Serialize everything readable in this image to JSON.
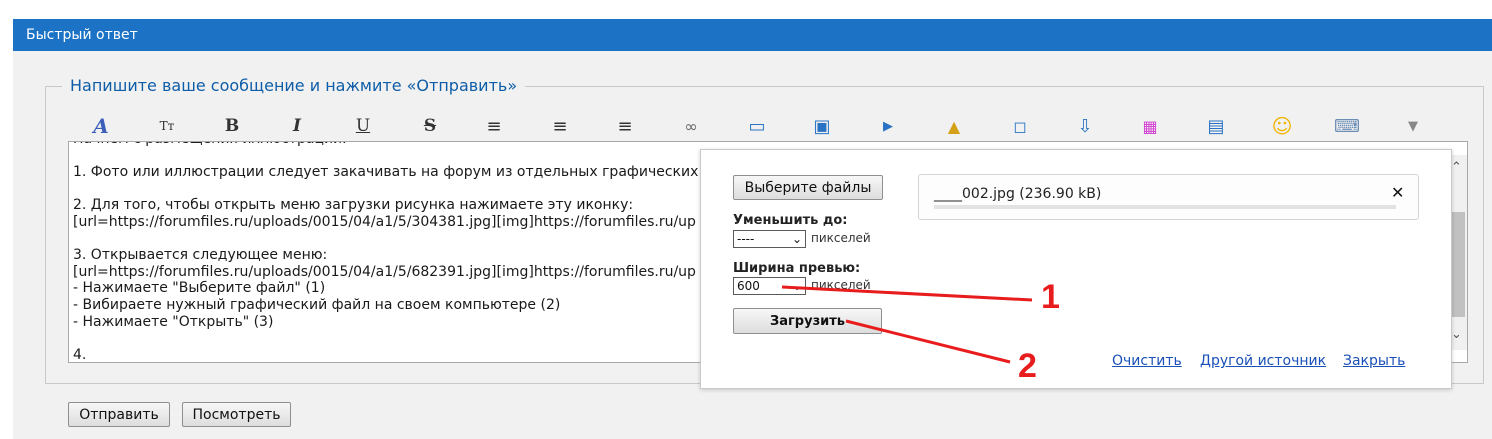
{
  "header": {
    "title": "Быстрый ответ"
  },
  "form": {
    "legend": "Напишите ваше сообщение и нажмите «Отправить»",
    "toolbar": [
      {
        "name": "font-color-icon",
        "glyph": "A"
      },
      {
        "name": "font-size-icon",
        "glyph": "Tт"
      },
      {
        "name": "bold-icon",
        "glyph": "B"
      },
      {
        "name": "italic-icon",
        "glyph": "I"
      },
      {
        "name": "underline-icon",
        "glyph": "U"
      },
      {
        "name": "strikethrough-icon",
        "glyph": "S"
      },
      {
        "name": "align-left-icon",
        "glyph": "≡"
      },
      {
        "name": "align-center-icon",
        "glyph": "≡"
      },
      {
        "name": "align-right-icon",
        "glyph": "≡"
      },
      {
        "name": "link-icon",
        "glyph": "∞"
      },
      {
        "name": "book-icon",
        "glyph": "▭"
      },
      {
        "name": "image-gallery-icon",
        "glyph": "▣"
      },
      {
        "name": "video-play-icon",
        "glyph": "▶"
      },
      {
        "name": "lock-icon",
        "glyph": "▲"
      },
      {
        "name": "quote-bubble-icon",
        "glyph": "◻"
      },
      {
        "name": "image-upload-icon",
        "glyph": "⇩"
      },
      {
        "name": "color-grid-icon",
        "glyph": "▦"
      },
      {
        "name": "table-icon",
        "glyph": "▤"
      },
      {
        "name": "smiley-icon",
        "glyph": "☺"
      },
      {
        "name": "keyboard-icon",
        "glyph": "⌨"
      },
      {
        "name": "more-dropdown-icon",
        "glyph": "▼"
      }
    ],
    "editor_text": "Начнем с размещения иллюстраций.\n\n1. Фото или иллюстрации следует закачивать на форум из отдельных графических фай\n\n2. Для того, чтобы открыть меню загрузки рисунка нажимаете эту иконку:\n[url=https://forumfiles.ru/uploads/0015/04/a1/5/304381.jpg][img]https://forumfiles.ru/up\n\n3. Открывается следующее меню:\n[url=https://forumfiles.ru/uploads/0015/04/a1/5/682391.jpg][img]https://forumfiles.ru/up\n- Нажимаете \"Выберите файл\" (1)\n- Вибираете нужный графический файл на своем компьютере (2)\n- Нажимаете \"Открыть\" (3)\n\n4.",
    "buttons": {
      "submit": "Отправить",
      "preview": "Посмотреть"
    }
  },
  "upload": {
    "choose_files": "Выберите файлы",
    "reduce_label": "Уменьшить до:",
    "reduce_value": "----",
    "reduce_unit": "пикселей",
    "preview_width_label": "Ширина превью:",
    "preview_width_value": "600",
    "preview_width_unit": "пикселей",
    "upload_button": "Загрузить",
    "file_name": "____002.jpg (236.90 kB)",
    "remove_glyph": "✕",
    "links": {
      "clear": "Очистить",
      "other_source": "Другой источник",
      "close": "Закрыть"
    }
  },
  "annotations": {
    "marker1": "1",
    "marker2": "2",
    "color": "#e81c1c"
  },
  "colors": {
    "header_bg": "#1c73c6",
    "link": "#1a50b8",
    "legend": "#0e5da8"
  }
}
